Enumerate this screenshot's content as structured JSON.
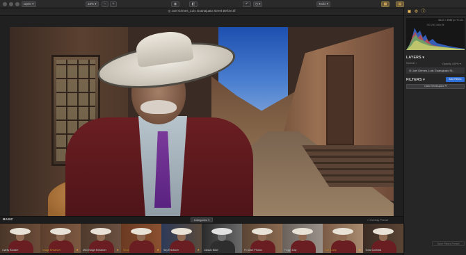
{
  "toolbar": {
    "open_label": "Open ▾",
    "zoom_label": "18% ▾",
    "zoom_out_label": "−",
    "zoom_in_label": "+",
    "view_icon": "eye-icon",
    "compare_icon": "compare-icon",
    "undo_icon": "undo-icon",
    "history_label": "◷ ▾",
    "tools_label": "Tools ▾",
    "layout_icon": "layout-icon",
    "panel_icon": "panel-icon"
  },
  "document": {
    "title": "◎ Joel Grimes_Luis Guanajuato Street Before.tif"
  },
  "panel": {
    "histogram": {
      "dimensions": "5312 × 3985 px  TC-01",
      "info": "ISO 200  1/60s  f/8"
    },
    "layers": {
      "header": "LAYERS ▾",
      "layer_name": "Normal ↕",
      "opacity": "Opacity 100% ▾",
      "row_label": "◎ Joel Grimes_Luis Guanajuato St..."
    },
    "filters": {
      "header": "FILTERS ▾",
      "add_button": "Add Filters",
      "clear_button": "Clear Workspace ▾"
    },
    "save_preset": "Save Filters Preset"
  },
  "presets": {
    "section_label": "BASIC",
    "categories_label": "Categories ▾",
    "overlay_label": "□ Overlay Preset",
    "items": [
      {
        "label": "Clarity Booster",
        "fav": false,
        "star": false
      },
      {
        "label": "Image Enhancer",
        "fav": true,
        "star": true
      },
      {
        "label": "Mild Image Enhancer",
        "fav": false,
        "star": true
      },
      {
        "label": "Vivid",
        "fav": true,
        "star": true
      },
      {
        "label": "Sky Enhancer",
        "fav": false,
        "star": true
      },
      {
        "label": "Classic B&W",
        "fav": false,
        "star": false
      },
      {
        "label": "Fix Dark Photos",
        "fav": false,
        "star": false
      },
      {
        "label": "Foggy Day",
        "fav": false,
        "star": false
      },
      {
        "label": "Soft & Airy",
        "fav": true,
        "star": true
      },
      {
        "label": "Tonal Contrast",
        "fav": false,
        "star": false
      }
    ]
  },
  "colors": {
    "accent": "#2f6fd6",
    "favorite": "#f2a73a",
    "background": "#1d1d1e"
  }
}
